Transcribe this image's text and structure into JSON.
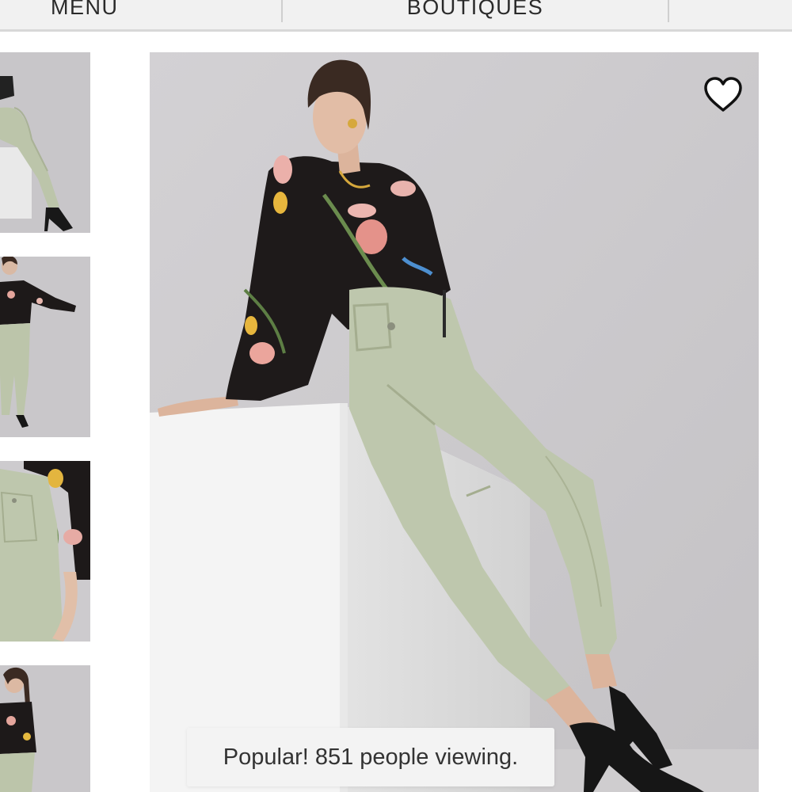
{
  "nav": {
    "menu_label": "MENU",
    "boutiques_label": "BOUTIQUES"
  },
  "gallery": {
    "thumbnails": [
      {
        "alt": "thumbnail-side-pose"
      },
      {
        "alt": "thumbnail-standing-pose"
      },
      {
        "alt": "thumbnail-pocket-detail"
      },
      {
        "alt": "thumbnail-full-length"
      }
    ],
    "main_image_alt": "Model seated on white block wearing floral blouse and sage cargo pants"
  },
  "favorite": {
    "icon": "heart-outline-icon",
    "active": false
  },
  "viewing_notice": {
    "text": "Popular! 851 people viewing."
  },
  "colors": {
    "backdrop": "#cfcdd0",
    "pants": "#bfc8ad",
    "blouse": "#1e1a1a",
    "block": "#f4f4f4"
  }
}
